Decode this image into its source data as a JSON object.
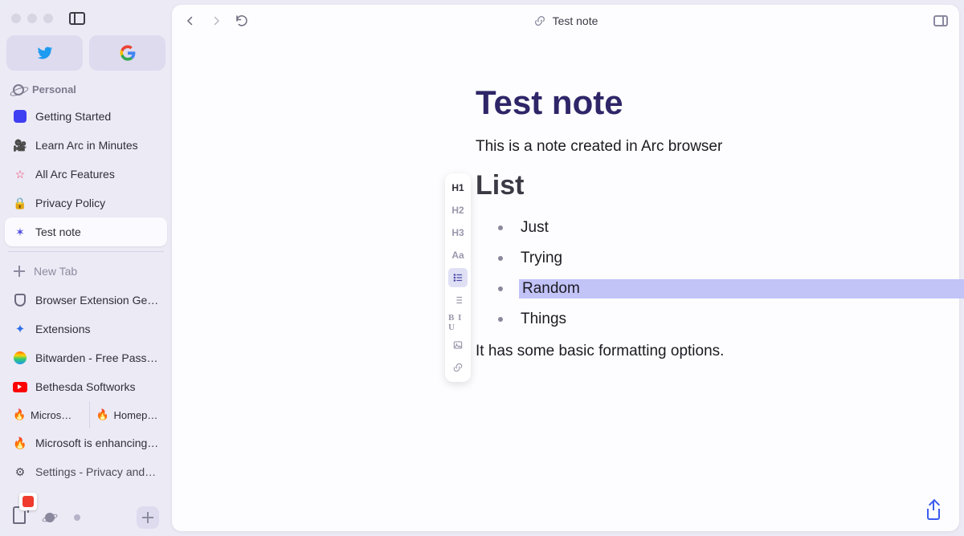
{
  "window": {
    "title": "Test note"
  },
  "sidebar": {
    "space_label": "Personal",
    "pinned": [
      {
        "label": "Getting Started",
        "icon": "square-blue"
      },
      {
        "label": "Learn Arc in Minutes",
        "icon": "video"
      },
      {
        "label": "All Arc Features",
        "icon": "star"
      },
      {
        "label": "Privacy Policy",
        "icon": "lock"
      },
      {
        "label": "Test note",
        "icon": "note",
        "active": true
      }
    ],
    "new_tab_label": "New Tab",
    "tabs": [
      {
        "label": "Browser Extension Getti…",
        "icon": "shield"
      },
      {
        "label": "Extensions",
        "icon": "puzzle"
      },
      {
        "label": "Bitwarden - Free Passw…",
        "icon": "bitwarden"
      },
      {
        "label": "Bethesda Softworks",
        "icon": "youtube"
      }
    ],
    "split": [
      {
        "label": "Micros…",
        "icon": "fire"
      },
      {
        "label": "Homep…",
        "icon": "fire"
      }
    ],
    "tabs2": [
      {
        "label": "Microsoft is enhancing…",
        "icon": "fire"
      },
      {
        "label": "Settings - Privacy and s…",
        "icon": "gear"
      }
    ]
  },
  "toolbar": {
    "h1": "H1",
    "h2": "H2",
    "h3": "H3",
    "aa": "Aa",
    "biu": "B I U"
  },
  "note": {
    "title": "Test note",
    "intro": "This is a note created in Arc browser",
    "list_heading": "List",
    "items": [
      "Just",
      "Trying",
      "Random",
      "Things"
    ],
    "selected_index": 2,
    "outro": "It has some basic formatting options."
  },
  "colors": {
    "accent": "#2e2668",
    "selection": "#c2c3f7"
  }
}
